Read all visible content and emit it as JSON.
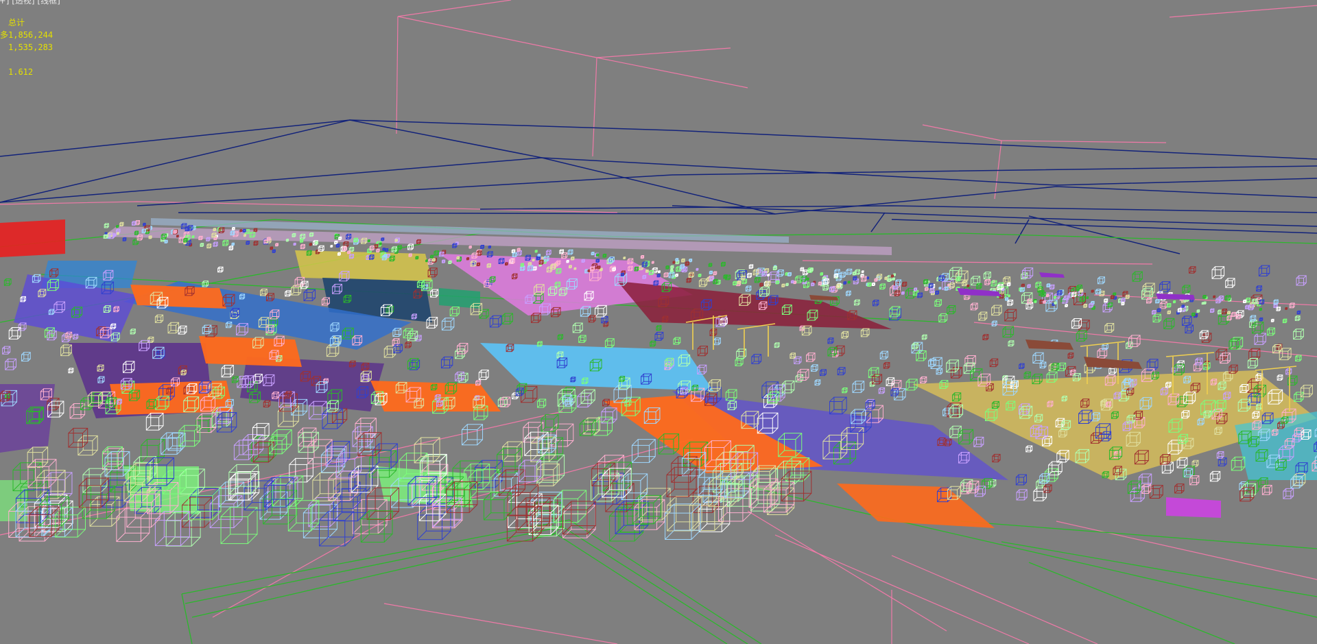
{
  "viewport": {
    "label": "[+] [透视] [线框]",
    "view": "perspective",
    "shading": "wireframe",
    "background_color": "#7f7f7f"
  },
  "statistics": {
    "title": "总计",
    "polys_prefix": "多",
    "polys": "1,856,244",
    "verts": "1,535,283",
    "fps": "1.612",
    "text_color": "#e4e000"
  },
  "scene": {
    "description_colors": [
      "#ff6a1c",
      "#5c4bd8",
      "#2f6fd0",
      "#59c8ff",
      "#e07be0",
      "#7cff7c",
      "#f0d050",
      "#8b1f3a",
      "#5a2f8c",
      "#e82020",
      "#10186e",
      "#ff7ab0",
      "#2bb82b"
    ]
  }
}
